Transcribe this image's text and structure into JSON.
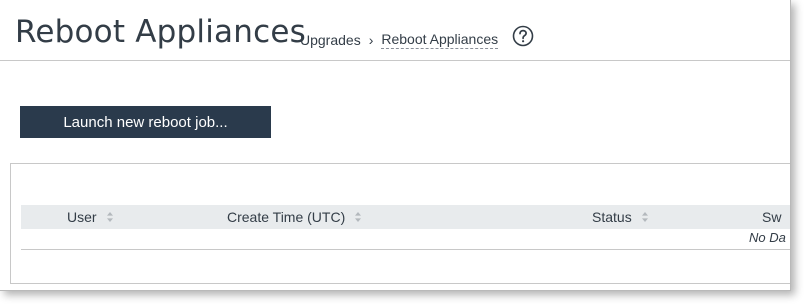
{
  "header": {
    "title": "Reboot Appliances",
    "breadcrumb": [
      {
        "label": "Upgrades"
      },
      {
        "label": "Reboot Appliances"
      }
    ],
    "breadcrumb_separator": "›",
    "help_icon": "question-circle-icon"
  },
  "toolbar": {
    "launch_label": "Launch new reboot job..."
  },
  "table": {
    "columns": [
      {
        "label": "User"
      },
      {
        "label": "Create Time (UTC)"
      },
      {
        "label": "Status"
      },
      {
        "label": "Sw"
      }
    ],
    "rows": [],
    "empty_message": "No Da"
  },
  "colors": {
    "text": "#333d47",
    "button_bg": "#2a3a4c",
    "header_row_bg": "#e8ebed",
    "border": "#c8c8c8"
  }
}
